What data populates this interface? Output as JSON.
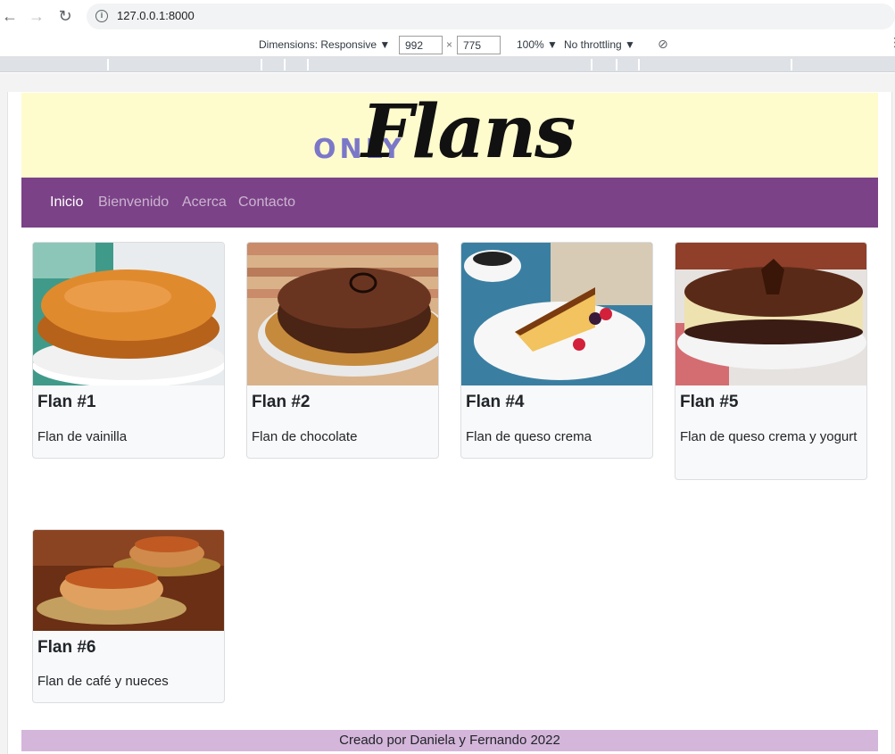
{
  "browser": {
    "url": "127.0.0.1:8000"
  },
  "device_toolbar": {
    "dimensions_label": "Dimensions: Responsive",
    "width": "992",
    "times": "×",
    "height": "775",
    "zoom": "100%",
    "throttling": "No throttling"
  },
  "site": {
    "logo_small": "ONLY",
    "logo_script": "Flans",
    "nav": [
      "Inicio",
      "Bienvenido",
      "Acerca",
      "Contacto"
    ],
    "cards": [
      {
        "title": "Flan #1",
        "text": "Flan de vainilla"
      },
      {
        "title": "Flan #2",
        "text": "Flan de chocolate"
      },
      {
        "title": "Flan #4",
        "text": "Flan de queso crema"
      },
      {
        "title": "Flan #5",
        "text": "Flan de queso crema y yogurt"
      },
      {
        "title": "Flan #6",
        "text": "Flan de café y nueces"
      }
    ],
    "footer": "Creado por Daniela y Fernando 2022"
  },
  "colors": {
    "banner": "#fefccd",
    "navbar": "#7b4287",
    "footer": "#d5b6db",
    "logo_accent": "#7b78c9"
  }
}
